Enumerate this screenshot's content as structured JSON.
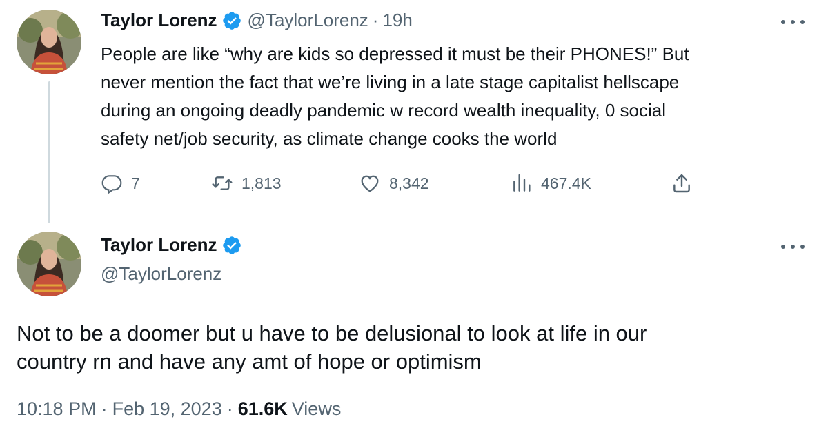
{
  "colors": {
    "verified_blue": "#1d9bf0",
    "secondary_text": "#536471",
    "primary_text": "#0f1419",
    "thread_line": "#cfd9de"
  },
  "reply_tweet": {
    "author_name": "Taylor Lorenz",
    "handle": "@TaylorLorenz",
    "separator": "·",
    "time": "19h",
    "text": "People are like “why are kids so depressed it must be their PHONES!” But\nnever mention the fact that we’re living in a late stage capitalist hellscape\nduring an ongoing deadly pandemic w record wealth inequality, 0 social\nsafety net/job security, as climate change cooks the world",
    "actions": {
      "replies": "7",
      "retweets": "1,813",
      "likes": "8,342",
      "views": "467.4K"
    },
    "icons": [
      "avatar",
      "verified-badge-icon",
      "more-icon",
      "reply-icon",
      "retweet-icon",
      "like-icon",
      "views-icon",
      "share-icon"
    ]
  },
  "main_tweet": {
    "author_name": "Taylor Lorenz",
    "handle": "@TaylorLorenz",
    "text": "Not to be a doomer but u have to be delusional to look at life in our\ncountry rn and have any amt of hope or optimism",
    "time": "10:18 PM",
    "separator": "·",
    "date": "Feb 19, 2023",
    "views_count": "61.6K",
    "views_label": "Views"
  }
}
